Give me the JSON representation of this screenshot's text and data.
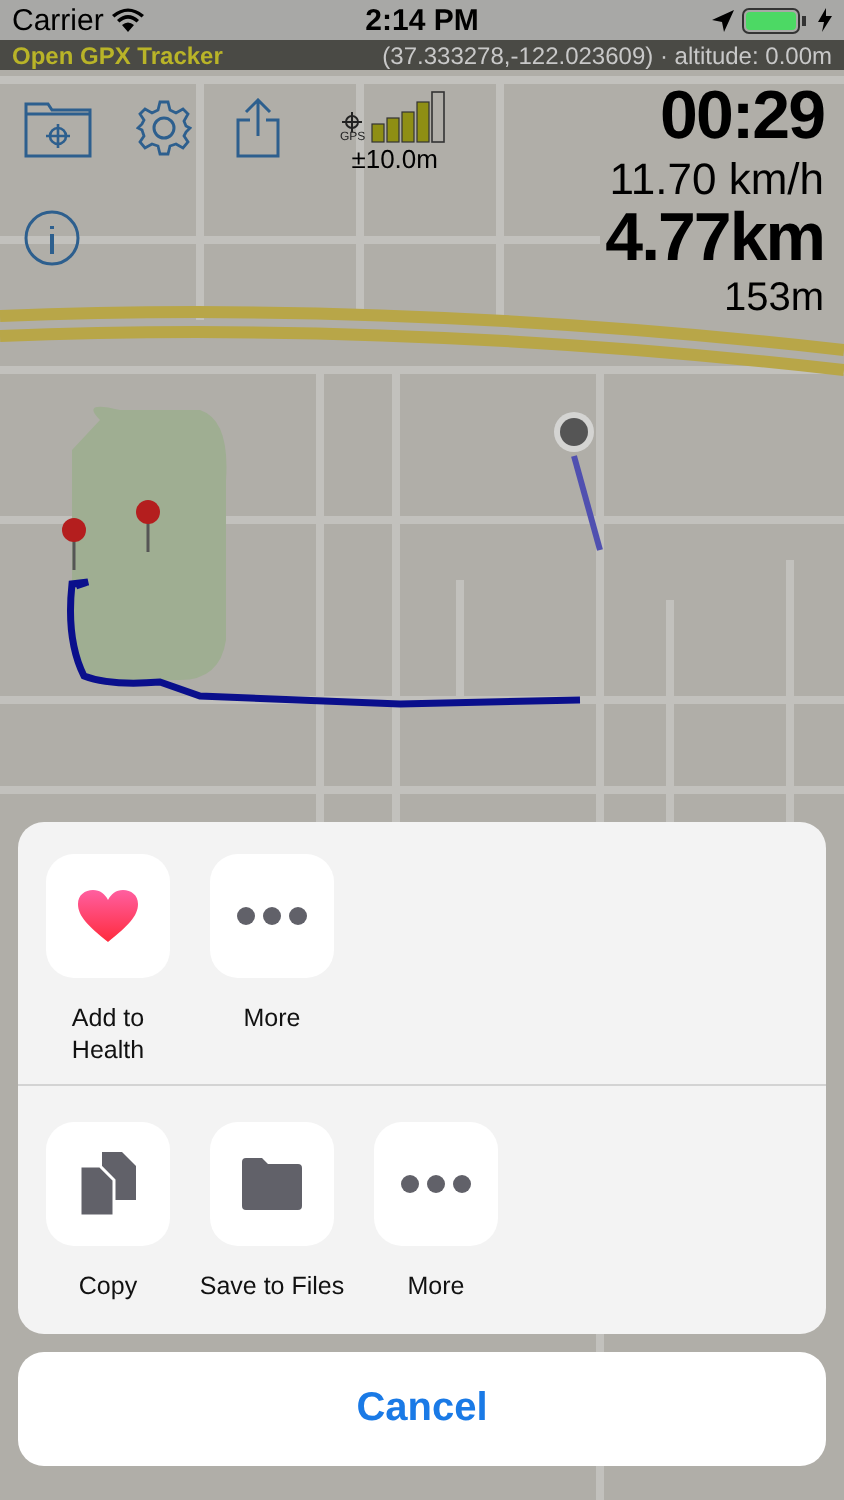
{
  "status_bar": {
    "carrier": "Carrier",
    "time": "2:14 PM"
  },
  "app_bar": {
    "title": "Open GPX Tracker",
    "coordinates": "(37.333278,-122.023609) · altitude: 0.00m"
  },
  "gps": {
    "label": "GPS",
    "accuracy": "±10.0m"
  },
  "stats": {
    "elapsed": "00:29",
    "speed": "11.70 km/h",
    "distance": "4.77km",
    "value_4": "153m"
  },
  "share_sheet": {
    "rows": [
      {
        "items": [
          {
            "kind": "health",
            "label": "Add to Health"
          },
          {
            "kind": "more",
            "label": "More"
          }
        ]
      },
      {
        "items": [
          {
            "kind": "copy",
            "label": "Copy"
          },
          {
            "kind": "files",
            "label": "Save to Files"
          },
          {
            "kind": "more",
            "label": "More"
          }
        ]
      }
    ]
  },
  "cancel": "Cancel"
}
